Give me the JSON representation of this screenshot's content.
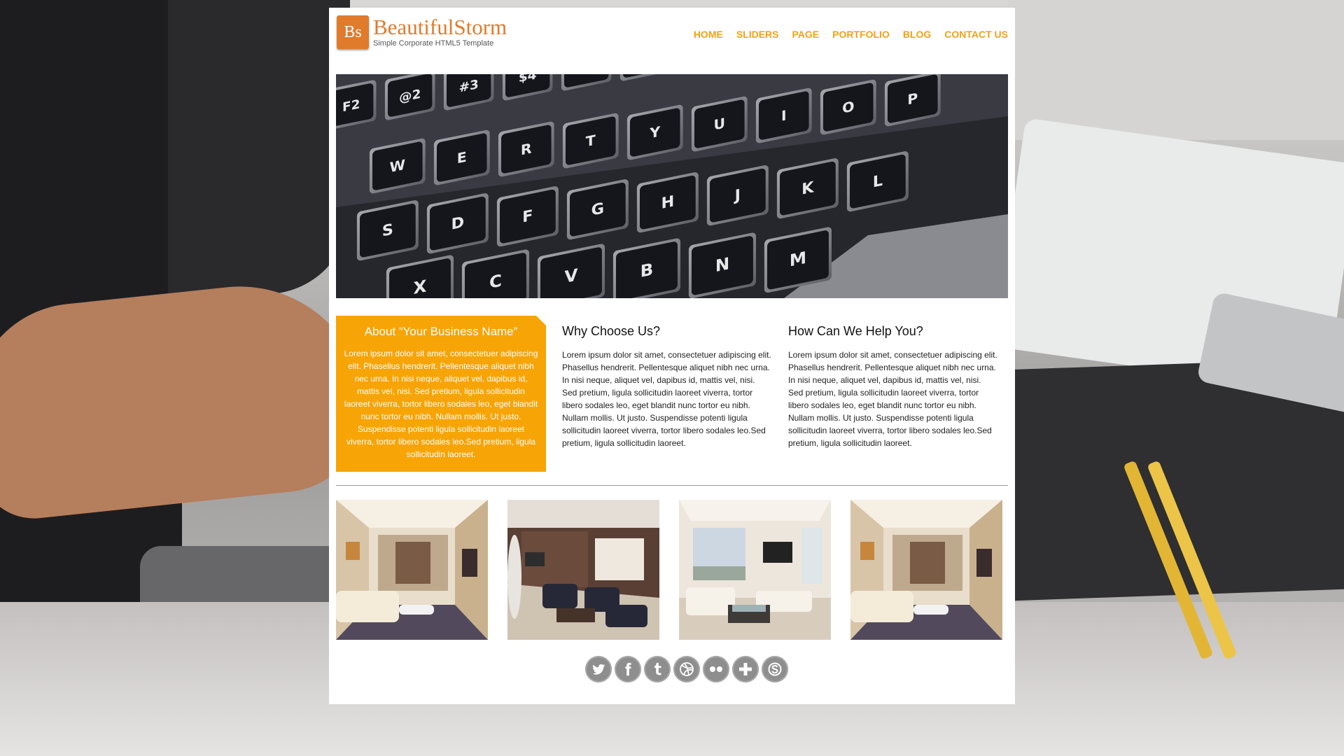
{
  "header": {
    "logo_mark": "Bs",
    "site_name": "BeautifulStorm",
    "tagline": "Simple Corporate HTML5 Template"
  },
  "nav": {
    "items": [
      "HOME",
      "SLIDERS",
      "PAGE",
      "PORTFOLIO",
      "BLOG",
      "CONTACT US"
    ]
  },
  "hero": {
    "keys": [
      "F2",
      "@2",
      "#3",
      "$4",
      "W",
      "E",
      "R",
      "T",
      "Y",
      "U",
      "I",
      "O",
      "P",
      "S",
      "D",
      "F",
      "G",
      "H",
      "J",
      "K",
      "L",
      "X",
      "C",
      "V",
      "B",
      "N",
      "M"
    ]
  },
  "about": {
    "title": "About “Your Business Name”",
    "text": "Lorem ipsum dolor sit amet, consectetuer adipiscing elit. Phasellus hendrerit. Pellentesque aliquet nibh nec urna. In nisi neque, aliquet vel, dapibus id, mattis vel, nisi. Sed pretium, ligula sollicitudin laoreet viverra, tortor libero sodales leo, eget blandit nunc tortor eu nibh. Nullam mollis. Ut justo. Suspendisse potenti ligula sollicitudin laoreet viverra, tortor libero sodales leo.Sed pretium, ligula sollicitudin laoreet."
  },
  "why": {
    "title": "Why Choose Us?",
    "text": "Lorem ipsum dolor sit amet, consectetuer adipiscing elit. Phasellus hendrerit. Pellentesque aliquet nibh nec urna. In nisi neque, aliquet vel, dapibus id, mattis vel, nisi. Sed pretium, ligula sollicitudin laoreet viverra, tortor libero sodales leo, eget blandit nunc tortor eu nibh. Nullam mollis. Ut justo. Suspendisse potenti ligula sollicitudin laoreet viverra, tortor libero sodales leo.Sed pretium, ligula sollicitudin laoreet."
  },
  "help": {
    "title": "How Can We Help You?",
    "text": "Lorem ipsum dolor sit amet, consectetuer adipiscing elit. Phasellus hendrerit. Pellentesque aliquet nibh nec urna. In nisi neque, aliquet vel, dapibus id, mattis vel, nisi. Sed pretium, ligula sollicitudin laoreet viverra, tortor libero sodales leo, eget blandit nunc tortor eu nibh. Nullam mollis. Ut justo. Suspendisse potenti ligula sollicitudin laoreet viverra, tortor libero sodales leo.Sed pretium, ligula sollicitudin laoreet."
  },
  "gallery": {
    "items": [
      "living-room-white-sofa",
      "lounge-dark-armchairs",
      "living-room-city-view",
      "living-room-white-sofa"
    ]
  },
  "social": {
    "icons": [
      "twitter-icon",
      "facebook-icon",
      "tumblr-icon",
      "dribbble-icon",
      "flickr-icon",
      "plus-icon",
      "skype-icon"
    ]
  },
  "colors": {
    "accent": "#f7a406",
    "logo": "#e07b2b",
    "nav": "#f0a21a"
  }
}
